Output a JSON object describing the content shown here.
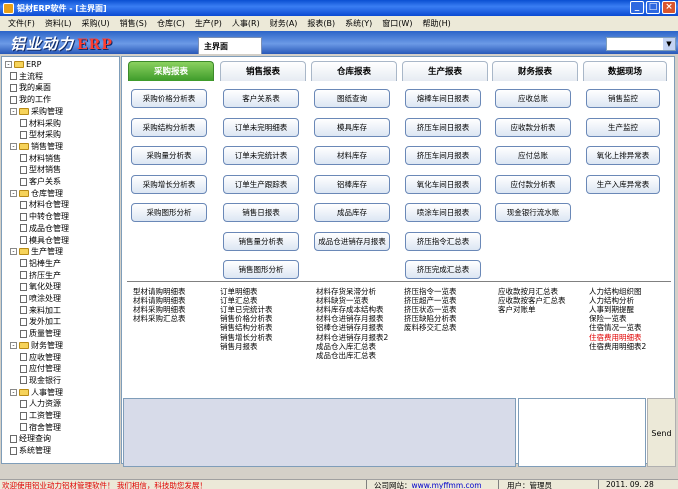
{
  "window": {
    "title": "铝材ERP软件 - [主界面]"
  },
  "menu": [
    "文件(F)",
    "资料(L)",
    "采购(U)",
    "销售(S)",
    "仓库(C)",
    "生产(P)",
    "人事(R)",
    "财务(A)",
    "报表(B)",
    "系统(Y)",
    "窗口(W)",
    "帮助(H)"
  ],
  "banner": {
    "logo_text": "铝业动力",
    "logo_erp": "ERP",
    "main_tab": "主界面"
  },
  "tree": [
    {
      "label": "ERP",
      "level": 0,
      "kind": "root"
    },
    {
      "label": "主流程",
      "level": 1,
      "kind": "doc"
    },
    {
      "label": "我的桌面",
      "level": 1,
      "kind": "doc"
    },
    {
      "label": "我的工作",
      "level": 1,
      "kind": "doc"
    },
    {
      "label": "采购管理",
      "level": 1,
      "kind": "folder"
    },
    {
      "label": "材料采购",
      "level": 2,
      "kind": "doc"
    },
    {
      "label": "型材采购",
      "level": 2,
      "kind": "doc"
    },
    {
      "label": "销售管理",
      "level": 1,
      "kind": "folder"
    },
    {
      "label": "材料销售",
      "level": 2,
      "kind": "doc"
    },
    {
      "label": "型材销售",
      "level": 2,
      "kind": "doc"
    },
    {
      "label": "客户关系",
      "level": 2,
      "kind": "doc"
    },
    {
      "label": "仓库管理",
      "level": 1,
      "kind": "folder"
    },
    {
      "label": "材料仓管理",
      "level": 2,
      "kind": "doc"
    },
    {
      "label": "中转仓管理",
      "level": 2,
      "kind": "doc"
    },
    {
      "label": "成品仓管理",
      "level": 2,
      "kind": "doc"
    },
    {
      "label": "模具仓管理",
      "level": 2,
      "kind": "doc"
    },
    {
      "label": "生产管理",
      "level": 1,
      "kind": "folder"
    },
    {
      "label": "铝棒生产",
      "level": 2,
      "kind": "doc"
    },
    {
      "label": "挤压生产",
      "level": 2,
      "kind": "doc"
    },
    {
      "label": "氧化处理",
      "level": 2,
      "kind": "doc"
    },
    {
      "label": "喷涂处理",
      "level": 2,
      "kind": "doc"
    },
    {
      "label": "来料加工",
      "level": 2,
      "kind": "doc"
    },
    {
      "label": "发外加工",
      "level": 2,
      "kind": "doc"
    },
    {
      "label": "质量管理",
      "level": 2,
      "kind": "doc"
    },
    {
      "label": "财务管理",
      "level": 1,
      "kind": "folder"
    },
    {
      "label": "应收管理",
      "level": 2,
      "kind": "doc"
    },
    {
      "label": "应付管理",
      "level": 2,
      "kind": "doc"
    },
    {
      "label": "现金银行",
      "level": 2,
      "kind": "doc"
    },
    {
      "label": "人事管理",
      "level": 1,
      "kind": "folder"
    },
    {
      "label": "人力资源",
      "level": 2,
      "kind": "doc"
    },
    {
      "label": "工资管理",
      "level": 2,
      "kind": "doc"
    },
    {
      "label": "宿舍管理",
      "level": 2,
      "kind": "doc"
    },
    {
      "label": "经理查询",
      "level": 1,
      "kind": "doc"
    },
    {
      "label": "系统管理",
      "level": 1,
      "kind": "doc"
    }
  ],
  "tabs": [
    {
      "label": "采购报表",
      "active": true
    },
    {
      "label": "销售报表",
      "active": false
    },
    {
      "label": "仓库报表",
      "active": false
    },
    {
      "label": "生产报表",
      "active": false
    },
    {
      "label": "财务报表",
      "active": false
    },
    {
      "label": "数据现场",
      "active": false
    }
  ],
  "columns": [
    [
      "采购价格分析表",
      "采购结构分析表",
      "采购量分析表",
      "采购增长分析表",
      "采购图形分析"
    ],
    [
      "客户关系表",
      "订单未完明细表",
      "订单未完统计表",
      "订单生产跟踪表",
      "销售日报表",
      "销售量分析表",
      "销售图形分析"
    ],
    [
      "图纸查询",
      "模具库存",
      "材料库存",
      "铝棒库存",
      "成品库存",
      "成品仓进销存月报表"
    ],
    [
      "熔棒车间日报表",
      "挤压车间日报表",
      "挤压车间月报表",
      "氧化车间日报表",
      "喷涂车间日报表",
      "挤压指令汇总表",
      "挤压完成汇总表"
    ],
    [
      "应收总账",
      "应收款分析表",
      "应付总账",
      "应付款分析表",
      "现金银行流水账"
    ],
    [
      "销售监控",
      "生产监控",
      "氧化上排异常表",
      "生产入库异常表"
    ]
  ],
  "link_columns": [
    [
      "型材请购明细表",
      "材料请购明细表",
      "材料采购明细表",
      "材料采购汇总表"
    ],
    [
      "订单明细表",
      "订单汇总表",
      "订单已完统计表",
      "销售价格分析表",
      "销售结构分析表",
      "销售增长分析表",
      "销售月报表"
    ],
    [
      "材料存货呆滞分析",
      "材料缺货一览表",
      "材料库存成本结构表",
      "材料仓进销存月报表",
      "铝棒仓进销存月报表",
      "材料仓进销存月报表2",
      "成品仓入库汇总表",
      "成品仓出库汇总表"
    ],
    [
      "挤压指令一览表",
      "挤压超产一览表",
      "挤压状态一览表",
      "挤压缺陷分析表",
      "废料移交汇总表"
    ],
    [
      "应收款按月汇总表",
      "应收款按客户汇总表",
      "客户对账单"
    ],
    [
      "人力结构组织图",
      "人力结构分析",
      "人事到期提醒",
      "保险一览表",
      "住宿情况一览表",
      "住宿费用明细表",
      "住宿费用明细表2"
    ]
  ],
  "highlight_link": "住宿费用明细表",
  "send_label": "Send",
  "status": {
    "message": "欢迎使用铝业动力铝材管理软件！ 我们相信，科技助您发展！",
    "site_label": "公司网站：",
    "site_url": "www.myffmm.com",
    "user": "用户：管理员",
    "date": "2011. 09. 28"
  }
}
